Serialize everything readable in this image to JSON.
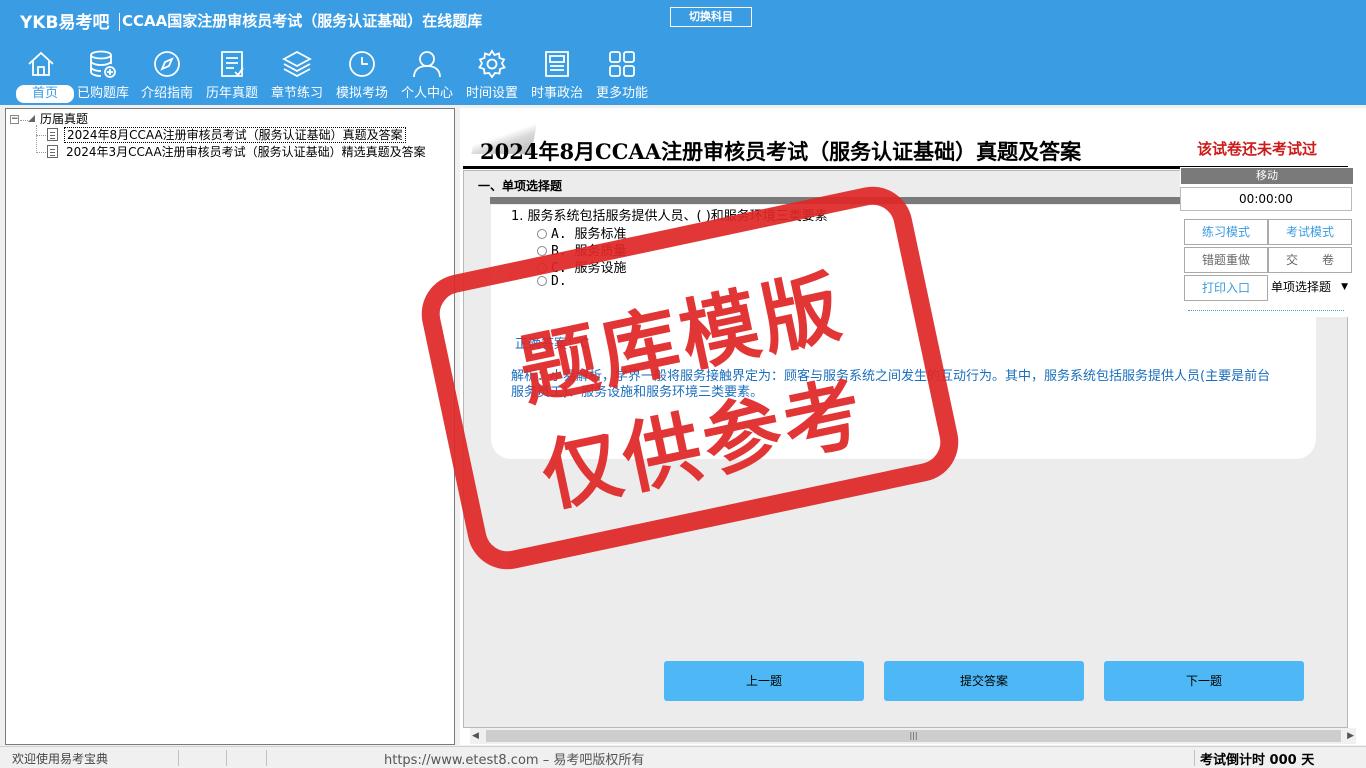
{
  "header": {
    "logo": "YKB易考吧",
    "title": "CCAA国家注册审核员考试（服务认证基础）在线题库",
    "switch_label": "切换科目"
  },
  "nav": [
    {
      "label": "首页",
      "icon": "home-icon"
    },
    {
      "label": "已购题库",
      "icon": "database-icon"
    },
    {
      "label": "介绍指南",
      "icon": "compass-icon"
    },
    {
      "label": "历年真题",
      "icon": "document-list-icon"
    },
    {
      "label": "章节练习",
      "icon": "layers-icon"
    },
    {
      "label": "模拟考场",
      "icon": "clock-icon"
    },
    {
      "label": "个人中心",
      "icon": "user-icon"
    },
    {
      "label": "时间设置",
      "icon": "gear-icon"
    },
    {
      "label": "时事政治",
      "icon": "news-icon"
    },
    {
      "label": "更多功能",
      "icon": "grid-icon"
    }
  ],
  "tree": {
    "root": "历届真题",
    "toggle": "−",
    "items": [
      "2024年8月CCAA注册审核员考试（服务认证基础）真题及答案",
      "2024年3月CCAA注册审核员考试（服务认证基础）精选真题及答案"
    ]
  },
  "exam": {
    "title": "2024年8月CCAA注册审核员考试（服务认证基础）真题及答案",
    "status": "该试卷还未考试过",
    "section": "一、单项选择题",
    "question": "1. 服务系统包括服务提供人员、( )和服务环境三类要素",
    "options": [
      "A. 服务标准",
      "B. 服务质量",
      "C. 服务设施",
      "D."
    ],
    "answer": "正确答案：C",
    "analysis": "解析：小易解析，学界一般将服务接触界定为：顾客与服务系统之间发生的互动行为。其中，服务系统包括服务提供人员(主要是前台服务员工)、服务设施和服务环境三类要素。",
    "buttons": {
      "prev": "上一题",
      "submit": "提交答案",
      "next": "下一题"
    }
  },
  "control": {
    "move": "移动",
    "timer": "00:00:00",
    "practice_mode": "练习模式",
    "exam_mode": "考试模式",
    "redo_wrong": "错题重做",
    "hand_in": "交　　卷",
    "print": "打印入口",
    "type_select": "单项选择题"
  },
  "watermark": {
    "line1": "题库模版",
    "line2": "仅供参考"
  },
  "statusbar": {
    "welcome": "欢迎使用易考宝典",
    "copyright": "https://www.etest8.com – 易考吧版权所有",
    "countdown": "考试倒计时 000 天"
  },
  "colors": {
    "header_bg": "#3a9ce3",
    "button_bg": "#4db8f5",
    "status_red": "#cc1b1b",
    "answer_blue": "#1a6fbd"
  }
}
